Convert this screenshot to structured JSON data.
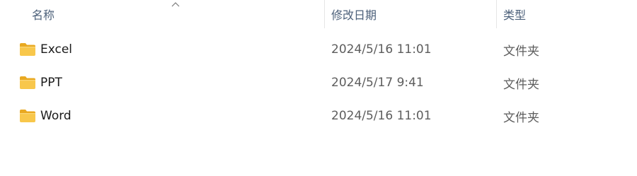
{
  "header": {
    "name_label": "名称",
    "date_label": "修改日期",
    "type_label": "类型",
    "sort_icon": "chevron-up-icon"
  },
  "rows": [
    {
      "name": "Excel",
      "date": "2024/5/16 11:01",
      "type": "文件夹",
      "icon": "folder-icon"
    },
    {
      "name": "PPT",
      "date": "2024/5/17 9:41",
      "type": "文件夹",
      "icon": "folder-icon"
    },
    {
      "name": "Word",
      "date": "2024/5/16 11:01",
      "type": "文件夹",
      "icon": "folder-icon"
    }
  ],
  "colors": {
    "header_text": "#4c607a",
    "folder_body": "#f8c74b",
    "folder_tab": "#e9a921"
  }
}
